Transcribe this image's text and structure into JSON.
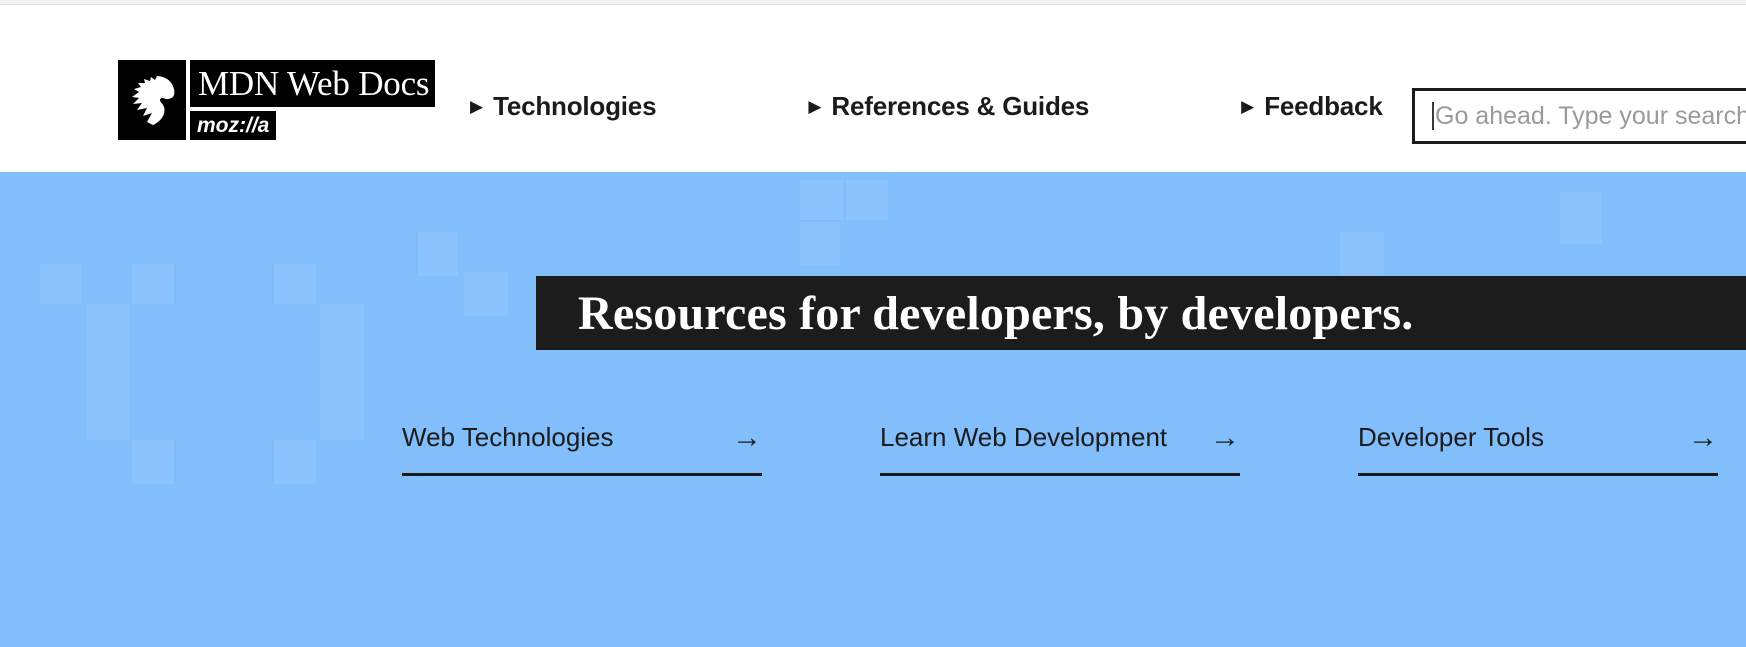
{
  "header": {
    "logo": {
      "mark_icon": "dino-head-icon",
      "wordmark": "MDN Web Docs",
      "sub_wordmark": "moz://a"
    },
    "nav": [
      {
        "caret": "▶",
        "label": "Technologies"
      },
      {
        "caret": "▶",
        "label": "References & Guides"
      },
      {
        "caret": "▶",
        "label": "Feedback"
      }
    ],
    "search": {
      "placeholder": "Go ahead. Type your search...",
      "value": "",
      "icon": "text-caret-icon"
    }
  },
  "hero": {
    "background_color": "#82bdfc",
    "banner_color": "#1c1c1c",
    "heading": "Resources for developers, by developers.",
    "links": [
      {
        "label": "Web Technologies",
        "arrow": "→"
      },
      {
        "label": "Learn Web Development",
        "arrow": "→"
      },
      {
        "label": "Developer Tools",
        "arrow": "→"
      }
    ]
  },
  "colors": {
    "accent_blue": "#82bdfc",
    "ink": "#1b1b1b",
    "banner": "#1c1c1c",
    "placeholder": "#9a9a9a"
  }
}
